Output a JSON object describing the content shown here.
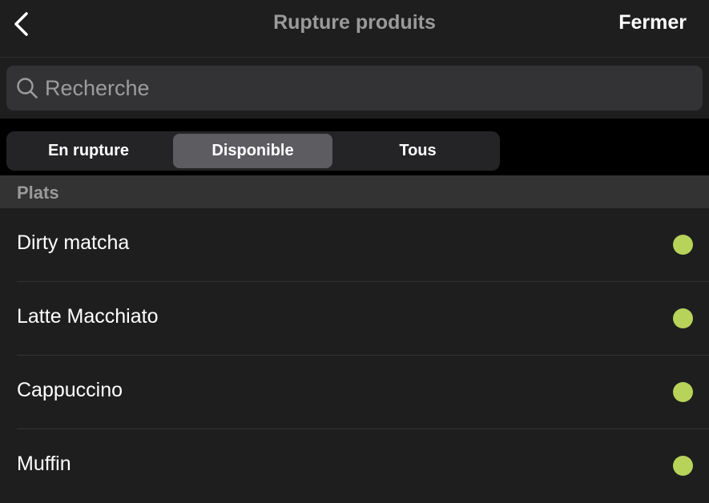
{
  "header": {
    "title": "Rupture produits",
    "close_label": "Fermer",
    "back_icon": "chevron-left-icon"
  },
  "search": {
    "placeholder": "Recherche",
    "value": "",
    "icon": "search-icon"
  },
  "filter_tabs": [
    {
      "label": "En rupture",
      "selected": false
    },
    {
      "label": "Disponible",
      "selected": true
    },
    {
      "label": "Tous",
      "selected": false
    }
  ],
  "section": {
    "title": "Plats"
  },
  "items": [
    {
      "label": "Dirty matcha",
      "status": "disponible"
    },
    {
      "label": "Latte Macchiato",
      "status": "disponible"
    },
    {
      "label": "Cappuccino",
      "status": "disponible"
    },
    {
      "label": "Muffin",
      "status": "disponible"
    }
  ],
  "colors": {
    "available": "#b7d35a",
    "background": "#1e1e1e",
    "selected_tab": "#5c5c61"
  }
}
